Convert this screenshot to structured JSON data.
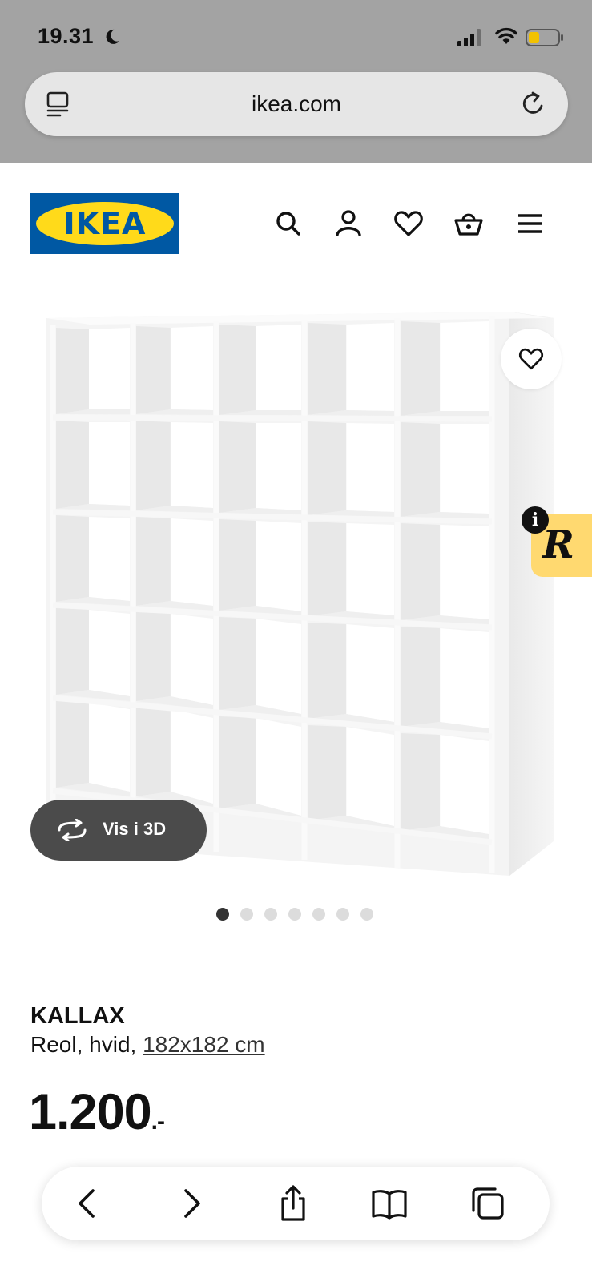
{
  "status_bar": {
    "time": "19.31",
    "icons": [
      "moon-icon",
      "cellular-signal-icon",
      "wifi-icon",
      "battery-icon"
    ]
  },
  "browser": {
    "url": "ikea.com",
    "icons": [
      "tab-overview-icon",
      "reload-icon"
    ]
  },
  "header": {
    "logo_text": "IKEA",
    "brand_colors": {
      "blue": "#0058a3",
      "yellow": "#ffda1a"
    },
    "icons": [
      "search-icon",
      "account-icon",
      "heart-icon",
      "basket-icon",
      "menu-icon"
    ]
  },
  "product": {
    "view_3d_label": "Vis i 3D",
    "image_count": 7,
    "active_image": 1,
    "name": "KALLAX",
    "description": "Reol, hvid,",
    "size_link": "182x182 cm",
    "price": "1.200",
    "price_suffix": ".-"
  },
  "overlay": {
    "extension_letter": "R",
    "info_letter": "i",
    "color": "#ffd970"
  },
  "bottom_bar": {
    "icons": [
      "back-icon",
      "forward-icon",
      "share-icon",
      "bookmarks-icon",
      "tabs-icon"
    ]
  }
}
